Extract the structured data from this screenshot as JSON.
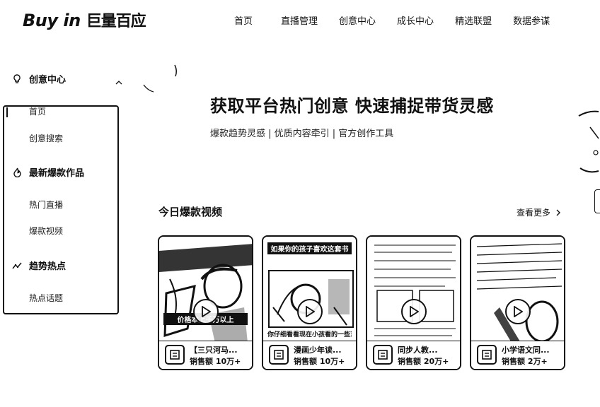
{
  "header": {
    "logo_en": "Buy in",
    "logo_cn": "巨量百应",
    "nav": [
      "首页",
      "直播管理",
      "创意中心",
      "成长中心",
      "精选联盟",
      "数据参谋"
    ]
  },
  "sidebar": {
    "groups": [
      {
        "label": "创意中心",
        "icon": "lightbulb-icon",
        "items": [
          "首页",
          "创意搜索"
        ]
      },
      {
        "label": "最新爆款作品",
        "icon": "flame-icon",
        "items": [
          "热门直播",
          "爆款视频"
        ]
      },
      {
        "label": "趋势热点",
        "icon": "trend-icon",
        "items": [
          "热点话题"
        ]
      }
    ]
  },
  "hero": {
    "title": "获取平台热门创意 快速捕捉带货灵感",
    "subtitle": "爆款趋势灵感 | 优质内容牵引 | 官方创作工具"
  },
  "section": {
    "title": "今日爆款视频",
    "more": "查看更多"
  },
  "cards": [
    {
      "title": "【三只河马...",
      "sales": "销售额 10万+",
      "overlay_top": "",
      "overlay_bottom": "价格本上千万以上",
      "caption": ""
    },
    {
      "title": "漫画少年读...",
      "sales": "销售额 10万+",
      "overlay_top": "如果你的孩子喜欢这套书",
      "overlay_bottom": "",
      "caption": "你仔细看看现在小孩看的一些东西"
    },
    {
      "title": "同步人教...",
      "sales": "销售额 20万+",
      "overlay_top": "",
      "overlay_bottom": "",
      "caption": ""
    },
    {
      "title": "小学语文同...",
      "sales": "销售额 2万+",
      "overlay_top": "",
      "overlay_bottom": "",
      "caption": ""
    }
  ]
}
